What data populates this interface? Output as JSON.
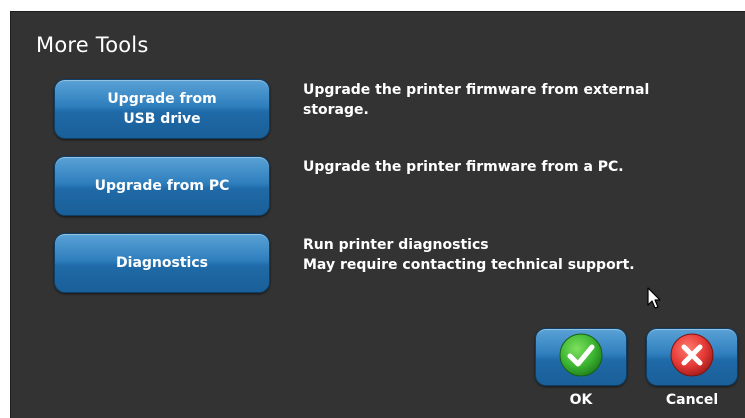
{
  "dialog": {
    "title": "More Tools"
  },
  "tools": [
    {
      "label": "Upgrade from\nUSB drive",
      "description": "Upgrade the printer firmware from external\nstorage."
    },
    {
      "label": "Upgrade from PC",
      "description": "Upgrade the printer firmware from a PC."
    },
    {
      "label": "Diagnostics",
      "description": "Run printer diagnostics\nMay require contacting technical support."
    }
  ],
  "actions": {
    "ok_label": "OK",
    "ok_icon": "check-circle-icon",
    "ok_color": "#3cb531",
    "cancel_label": "Cancel",
    "cancel_icon": "x-circle-icon",
    "cancel_color": "#e53935"
  },
  "colors": {
    "background": "#333333",
    "button": "#2f7fbe"
  }
}
